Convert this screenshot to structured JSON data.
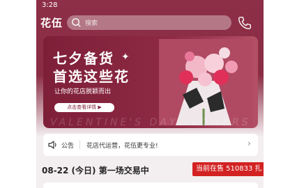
{
  "status_bar": {
    "time": "3:28"
  },
  "header": {
    "logo": "花伍",
    "search_placeholder": "搜索",
    "search_icon": "search-icon",
    "phone_icon": "phone-icon"
  },
  "banner": {
    "title_line1": "七夕备货",
    "title_line2": "首选这些花",
    "subtitle": "让你的花店脱颖而出",
    "button_label": "点击查看详情 ▶",
    "watermark": "VALENTINE'S DAY FLOWERS"
  },
  "notice": {
    "icon": "speaker-icon",
    "label": "公告",
    "text": "花店代运营，花伍更专业!",
    "chevron": "›"
  },
  "trade": {
    "session": "08-22 (今日) 第一场交易中",
    "badge": "当前在售 510833 扎"
  },
  "colors": {
    "brand": "#8d2f46",
    "badge": "#d32222"
  }
}
